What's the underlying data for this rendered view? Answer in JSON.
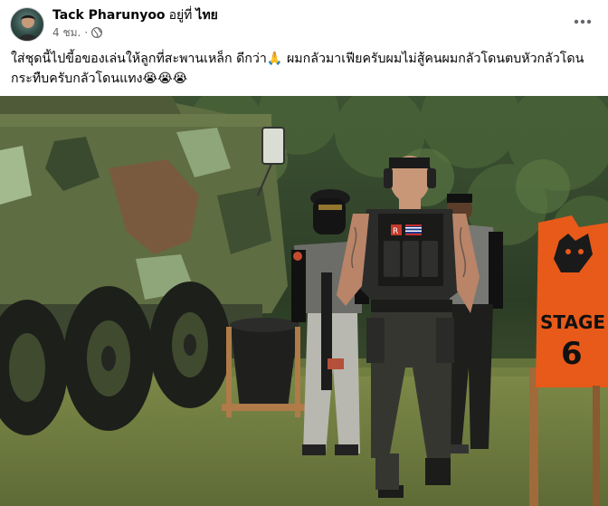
{
  "post": {
    "author_name": "Tack Pharunyoo",
    "at_label": "อยู่ที่",
    "place": "ไทย",
    "time": "4 ชม.",
    "separator": "·",
    "privacy_icon": "globe-icon",
    "more_icon": "more-dots-icon",
    "text": "ใส่ชุดนี้ไปขี้อของเล่นให้ลูกที่สะพานเหล็ก ดีกว่า🙏 ผมกลัวมาเฟียครับผมไม่สู้คนผมกลัวโดนตบหัวกลัวโดนกระทืบครับกลัวโดนแทง😭😭😭"
  },
  "photo": {
    "sign_text": "STAGE",
    "sign_number": "6",
    "patch_text": "R"
  },
  "colors": {
    "text": "#050505",
    "meta": "#65676b",
    "sign_orange": "#e85a1a"
  }
}
